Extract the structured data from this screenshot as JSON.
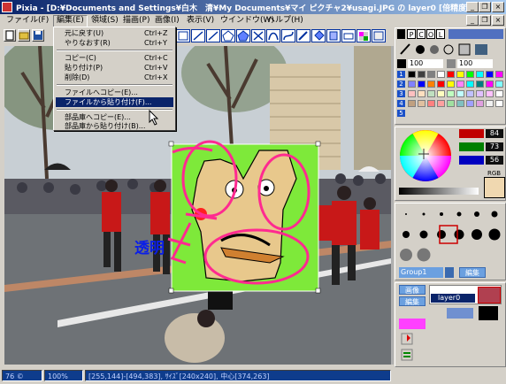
{
  "window": {
    "title": "Pixia - [D:¥Documents and Settings¥白木　清¥My Documents¥マイ ピクチャ2¥usagi.JPG の layer0 [倍精度]]",
    "minimize_glyph": "_",
    "restore_glyph": "❐",
    "close_glyph": "×"
  },
  "menubar": [
    {
      "label": "ファイル(F)",
      "active": false
    },
    {
      "label": "編集(E)",
      "active": true
    },
    {
      "label": "領域(S)",
      "active": false
    },
    {
      "label": "描画(P)",
      "active": false
    },
    {
      "label": "画像(I)",
      "active": false
    },
    {
      "label": "表示(V)",
      "active": false
    },
    {
      "label": "ウインドウ(W)",
      "active": false
    },
    {
      "label": "ヘルプ(H)",
      "active": false
    }
  ],
  "mdi_buttons": {
    "minimize": "_",
    "restore": "❐",
    "close": "×"
  },
  "edit_menu": {
    "items": [
      {
        "label": "元に戻す(U)",
        "shortcut": "Ctrl+Z"
      },
      {
        "label": "やりなおす(R)",
        "shortcut": "Ctrl+Y"
      },
      {
        "label": "コピー(C)",
        "shortcut": "Ctrl+C"
      },
      {
        "label": "貼り付け(P)",
        "shortcut": "Ctrl+V"
      },
      {
        "label": "削除(D)",
        "shortcut": "Ctrl+X"
      },
      {
        "label": "ファイルへコピー(E)...",
        "shortcut": ""
      },
      {
        "label": "ファイルから貼り付け(F)...",
        "shortcut": "",
        "selected": true
      },
      {
        "label": "部品庫へコピー(E)...",
        "shortcut": ""
      },
      {
        "label": "部品庫から貼り付け(B)...",
        "shortcut": ""
      }
    ]
  },
  "canvas": {
    "overlay_text": "透明"
  },
  "palette": {
    "mode_labels": [
      "P",
      "C",
      "O",
      "L"
    ],
    "values": [
      "100",
      "100"
    ],
    "rows": [
      "1",
      "2",
      "3",
      "4",
      "5"
    ],
    "colors": [
      [
        "#000000",
        "#404040",
        "#808080",
        "#ffffff",
        "#ff0000",
        "#ffff00",
        "#00ff00",
        "#00ffff",
        "#0000ff",
        "#ff00ff"
      ],
      [
        "#8080ff",
        "#0000ff",
        "#ff8000",
        "#ff0000",
        "#ffff00",
        "#ff80ff",
        "#00ffff",
        "#008080",
        "#ff00ff",
        "#80ffff"
      ],
      [
        "#ffc0c0",
        "#ffe0c0",
        "#c0e0c0",
        "#ffffc0",
        "#c0ffc0",
        "#c0ffff",
        "#c0c0ff",
        "#e0c0ff",
        "#ffc0ff",
        "#ffffff"
      ],
      [
        "#c0a080",
        "#e0c0a0",
        "#ff8080",
        "#ffa0a0",
        "#a0e0a0",
        "#80c0c0",
        "#a0a0ff",
        "#e0a0e0",
        "#f0f0f0",
        "#ffffff"
      ]
    ]
  },
  "color_picker": {
    "rgb_values": [
      "84",
      "73",
      "56"
    ],
    "rgb_label": "RGB",
    "current_color": "#f0d8b0"
  },
  "brush_panel": {
    "group_label": "Group1",
    "edit_label": "編集"
  },
  "layer_panel": {
    "image_btn": "画像",
    "edit_btn": "編集",
    "layer_name": "layer0"
  },
  "statusbar": {
    "zoom1": "76 ©",
    "zoom2": "100%",
    "coords": "[255,144]-[494,383], ｻｲｽﾞ[240x240], 中心[374,263]"
  }
}
